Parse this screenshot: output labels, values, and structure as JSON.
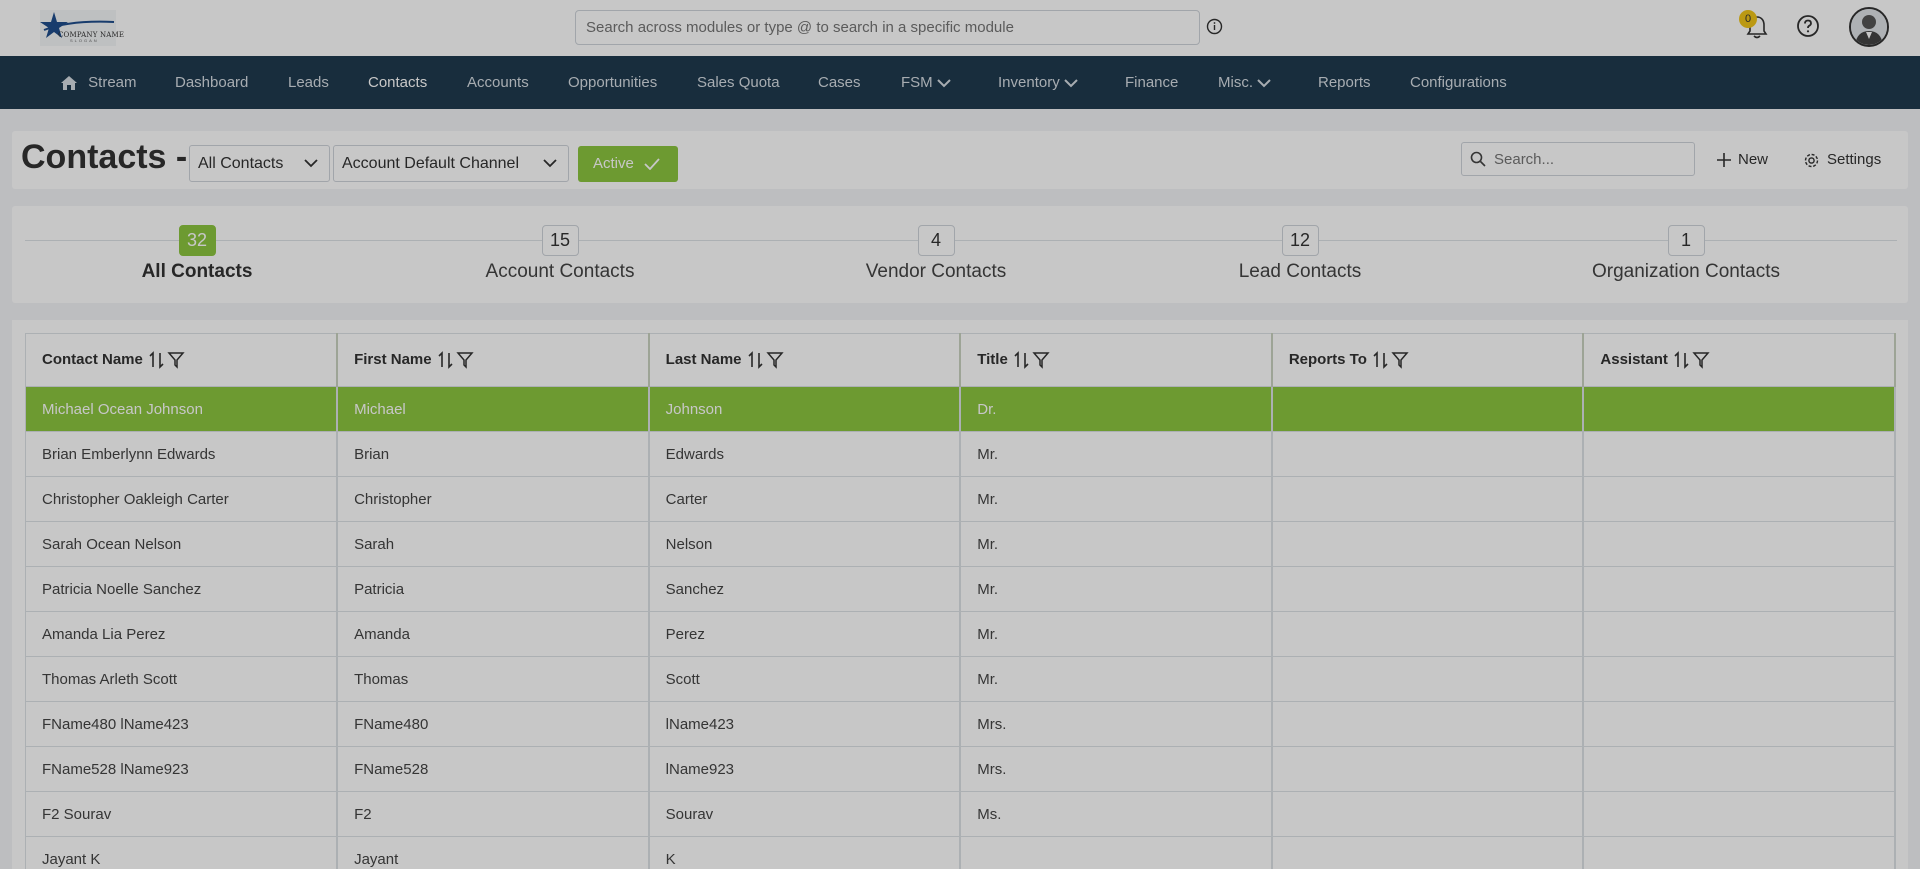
{
  "app": {
    "logo_text": "COMPANY NAME",
    "logo_sub": "SLOGAN",
    "global_search_placeholder": "Search across modules or type @ to search in a specific module",
    "notification_count": "0"
  },
  "nav": {
    "items": [
      {
        "label": "Stream",
        "icon": "home-icon"
      },
      {
        "label": "Dashboard"
      },
      {
        "label": "Leads"
      },
      {
        "label": "Contacts",
        "active": true
      },
      {
        "label": "Accounts"
      },
      {
        "label": "Opportunities"
      },
      {
        "label": "Sales Quota"
      },
      {
        "label": "Cases"
      },
      {
        "label": "FSM",
        "dropdown": true
      },
      {
        "label": "Inventory",
        "dropdown": true
      },
      {
        "label": "Finance"
      },
      {
        "label": "Misc.",
        "dropdown": true
      },
      {
        "label": "Reports"
      },
      {
        "label": "Configurations"
      }
    ]
  },
  "header": {
    "title": "Contacts -",
    "view_select": "All Contacts",
    "channel_select": "Account Default Channel",
    "status_button": "Active",
    "search_placeholder": "Search...",
    "new_label": "New",
    "settings_label": "Settings"
  },
  "stats": [
    {
      "count": "32",
      "label": "All Contacts",
      "selected": true
    },
    {
      "count": "15",
      "label": "Account Contacts"
    },
    {
      "count": "4",
      "label": "Vendor Contacts"
    },
    {
      "count": "12",
      "label": "Lead Contacts"
    },
    {
      "count": "1",
      "label": "Organization Contacts"
    }
  ],
  "table": {
    "columns": [
      "Contact Name",
      "First Name",
      "Last Name",
      "Title",
      "Reports To",
      "Assistant"
    ],
    "rows": [
      [
        "Michael Ocean Johnson",
        "Michael",
        "Johnson",
        "Dr.",
        "",
        ""
      ],
      [
        "Brian Emberlynn Edwards",
        "Brian",
        "Edwards",
        "Mr.",
        "",
        ""
      ],
      [
        "Christopher Oakleigh Carter",
        "Christopher",
        "Carter",
        "Mr.",
        "",
        ""
      ],
      [
        "Sarah Ocean Nelson",
        "Sarah",
        "Nelson",
        "Mr.",
        "",
        ""
      ],
      [
        "Patricia Noelle Sanchez",
        "Patricia",
        "Sanchez",
        "Mr.",
        "",
        ""
      ],
      [
        "Amanda Lia Perez",
        "Amanda",
        "Perez",
        "Mr.",
        "",
        ""
      ],
      [
        "Thomas Arleth Scott",
        "Thomas",
        "Scott",
        "Mr.",
        "",
        ""
      ],
      [
        "FName480 lName423",
        "FName480",
        "lName423",
        "Mrs.",
        "",
        ""
      ],
      [
        "FName528 lName923",
        "FName528",
        "lName923",
        "Mrs.",
        "",
        ""
      ],
      [
        "F2 Sourav",
        "F2",
        "Sourav",
        "Ms.",
        "",
        ""
      ],
      [
        "Jayant K",
        "Jayant",
        "K",
        "",
        "",
        ""
      ]
    ],
    "selected_row": 0
  },
  "colors": {
    "nav_bg": "#1f3a4f",
    "accent_green": "#8cc63f",
    "badge_yellow": "#f0c419"
  }
}
